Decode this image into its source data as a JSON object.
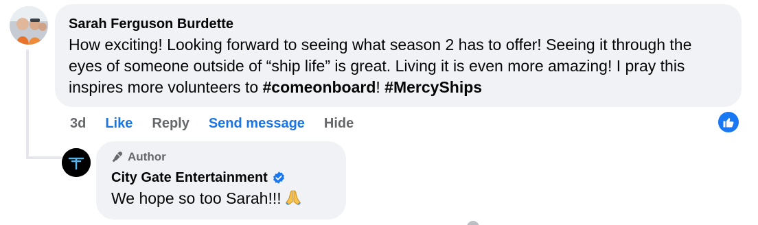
{
  "comment": {
    "author": "Sarah Ferguson Burdette",
    "text_parts": [
      "How exciting! Looking forward to seeing what season 2 has to offer! Seeing it through the eyes of someone outside of “ship life” is great. Living it is even more amazing! I pray this inspires more volunteers to ",
      "#comeonboard",
      "! ",
      "#MercyShips"
    ],
    "time": "3d",
    "actions": {
      "like": "Like",
      "reply": "Reply",
      "send_message": "Send message",
      "hide": "Hide"
    },
    "reaction_icon": "thumbs-up-icon"
  },
  "reply": {
    "badge": "Author",
    "author": "City Gate Entertainment",
    "verified": true,
    "text": "We hope so too Sarah!!!",
    "emoji": "folded-hands-icon"
  },
  "colors": {
    "accent": "#1b74e4",
    "bubble_bg": "#f0f2f5",
    "muted_text": "#65676b"
  }
}
